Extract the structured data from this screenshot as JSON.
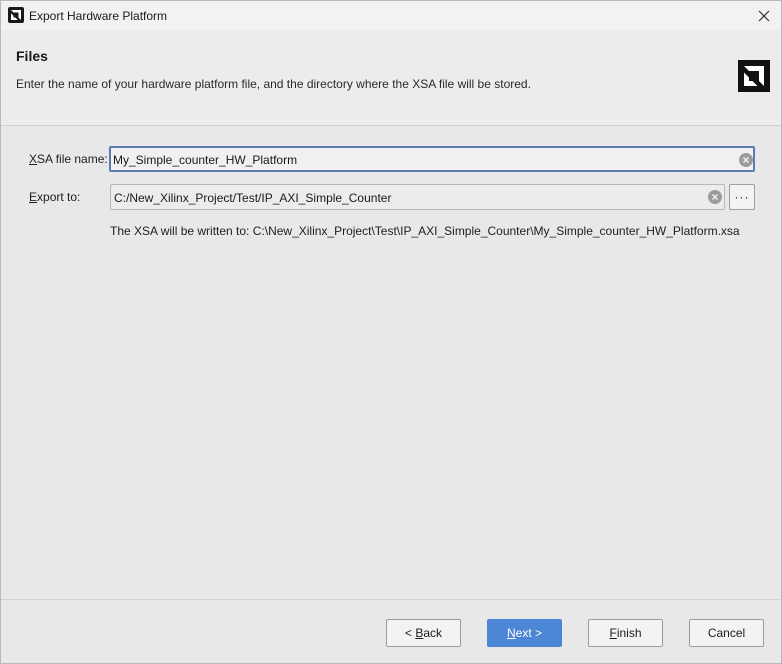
{
  "window": {
    "title": "Export Hardware Platform"
  },
  "header": {
    "title": "Files",
    "description": "Enter the name of your hardware platform file, and the directory where the XSA file will be stored."
  },
  "form": {
    "xsa_file_name": {
      "label_mnemonic": "X",
      "label_rest": "SA file name:",
      "value": "My_Simple_counter_HW_Platform"
    },
    "export_to": {
      "label_mnemonic": "E",
      "label_rest": "xport to:",
      "value": "C:/New_Xilinx_Project/Test/IP_AXI_Simple_Counter",
      "browse_label": "···"
    },
    "written_to_text": "The XSA will be written to: C:\\New_Xilinx_Project\\Test\\IP_AXI_Simple_Counter\\My_Simple_counter_HW_Platform.xsa"
  },
  "buttons": {
    "back": {
      "prefix": "< ",
      "mnemonic": "B",
      "rest": "ack"
    },
    "next": {
      "mnemonic": "N",
      "rest": "ext >"
    },
    "finish": {
      "mnemonic": "F",
      "rest": "inish"
    },
    "cancel": {
      "label": "Cancel"
    }
  },
  "colors": {
    "primary_button": "#4e86d6",
    "focus_border": "#5b7db3"
  },
  "icons": {
    "app": "amd-logo-icon",
    "header_logo": "amd-logo-icon",
    "close": "close-icon",
    "clear": "clear-circle-icon",
    "browse": "ellipsis-icon"
  }
}
